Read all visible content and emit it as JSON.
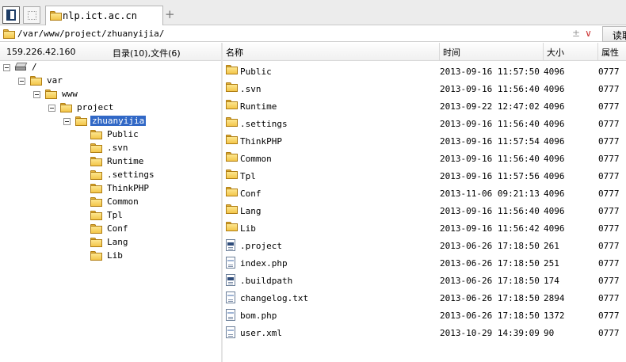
{
  "tab": {
    "title": "nlp.ict.ac.cn",
    "add_label": "+"
  },
  "pathbar": {
    "path": "/var/www/project/zhuanyijia/",
    "up_symbol": "±",
    "chevron_symbol": "∨",
    "read_label": "读取"
  },
  "info": {
    "ip": "159.226.42.160",
    "count": "目录(10),文件(6)"
  },
  "columns": {
    "name": "名称",
    "time": "时间",
    "size": "大小",
    "attr": "属性"
  },
  "tree": [
    {
      "label": "/",
      "icon": "drive-icon",
      "depth": 0,
      "selected": false,
      "expander": true
    },
    {
      "label": "var",
      "icon": "folder-icon",
      "depth": 1,
      "selected": false,
      "expander": true
    },
    {
      "label": "www",
      "icon": "folder-icon",
      "depth": 2,
      "selected": false,
      "expander": true
    },
    {
      "label": "project",
      "icon": "folder-icon",
      "depth": 3,
      "selected": false,
      "expander": true
    },
    {
      "label": "zhuanyijia",
      "icon": "open-folder-icon",
      "depth": 4,
      "selected": true,
      "expander": true
    },
    {
      "label": "Public",
      "icon": "folder-icon",
      "depth": 5,
      "selected": false,
      "expander": false
    },
    {
      "label": ".svn",
      "icon": "folder-icon",
      "depth": 5,
      "selected": false,
      "expander": false
    },
    {
      "label": "Runtime",
      "icon": "folder-icon",
      "depth": 5,
      "selected": false,
      "expander": false
    },
    {
      "label": ".settings",
      "icon": "folder-icon",
      "depth": 5,
      "selected": false,
      "expander": false
    },
    {
      "label": "ThinkPHP",
      "icon": "folder-icon",
      "depth": 5,
      "selected": false,
      "expander": false
    },
    {
      "label": "Common",
      "icon": "folder-icon",
      "depth": 5,
      "selected": false,
      "expander": false
    },
    {
      "label": "Tpl",
      "icon": "folder-icon",
      "depth": 5,
      "selected": false,
      "expander": false
    },
    {
      "label": "Conf",
      "icon": "folder-icon",
      "depth": 5,
      "selected": false,
      "expander": false
    },
    {
      "label": "Lang",
      "icon": "folder-icon",
      "depth": 5,
      "selected": false,
      "expander": false
    },
    {
      "label": "Lib",
      "icon": "folder-icon",
      "depth": 5,
      "selected": false,
      "expander": false
    }
  ],
  "files": [
    {
      "name": "Public",
      "time": "2013-09-16 11:57:50",
      "size": "4096",
      "attr": "0777",
      "icon": "folder-icon"
    },
    {
      "name": ".svn",
      "time": "2013-09-16 11:56:40",
      "size": "4096",
      "attr": "0777",
      "icon": "folder-icon"
    },
    {
      "name": "Runtime",
      "time": "2013-09-22 12:47:02",
      "size": "4096",
      "attr": "0777",
      "icon": "folder-icon"
    },
    {
      "name": ".settings",
      "time": "2013-09-16 11:56:40",
      "size": "4096",
      "attr": "0777",
      "icon": "folder-icon"
    },
    {
      "name": "ThinkPHP",
      "time": "2013-09-16 11:57:54",
      "size": "4096",
      "attr": "0777",
      "icon": "folder-icon"
    },
    {
      "name": "Common",
      "time": "2013-09-16 11:56:40",
      "size": "4096",
      "attr": "0777",
      "icon": "folder-icon"
    },
    {
      "name": "Tpl",
      "time": "2013-09-16 11:57:56",
      "size": "4096",
      "attr": "0777",
      "icon": "folder-icon"
    },
    {
      "name": "Conf",
      "time": "2013-11-06 09:21:13",
      "size": "4096",
      "attr": "0777",
      "icon": "folder-icon"
    },
    {
      "name": "Lang",
      "time": "2013-09-16 11:56:40",
      "size": "4096",
      "attr": "0777",
      "icon": "folder-icon"
    },
    {
      "name": "Lib",
      "time": "2013-09-16 11:56:42",
      "size": "4096",
      "attr": "0777",
      "icon": "folder-icon"
    },
    {
      "name": ".project",
      "time": "2013-06-26 17:18:50",
      "size": "261",
      "attr": "0777",
      "icon": "file-icon"
    },
    {
      "name": "index.php",
      "time": "2013-06-26 17:18:50",
      "size": "251",
      "attr": "0777",
      "icon": "doc-icon"
    },
    {
      "name": ".buildpath",
      "time": "2013-06-26 17:18:50",
      "size": "174",
      "attr": "0777",
      "icon": "file-icon"
    },
    {
      "name": "changelog.txt",
      "time": "2013-06-26 17:18:50",
      "size": "2894",
      "attr": "0777",
      "icon": "doc-icon"
    },
    {
      "name": "bom.php",
      "time": "2013-06-26 17:18:50",
      "size": "1372",
      "attr": "0777",
      "icon": "doc-icon"
    },
    {
      "name": "user.xml",
      "time": "2013-10-29 14:39:09",
      "size": "90",
      "attr": "0777",
      "icon": "doc-icon"
    }
  ]
}
